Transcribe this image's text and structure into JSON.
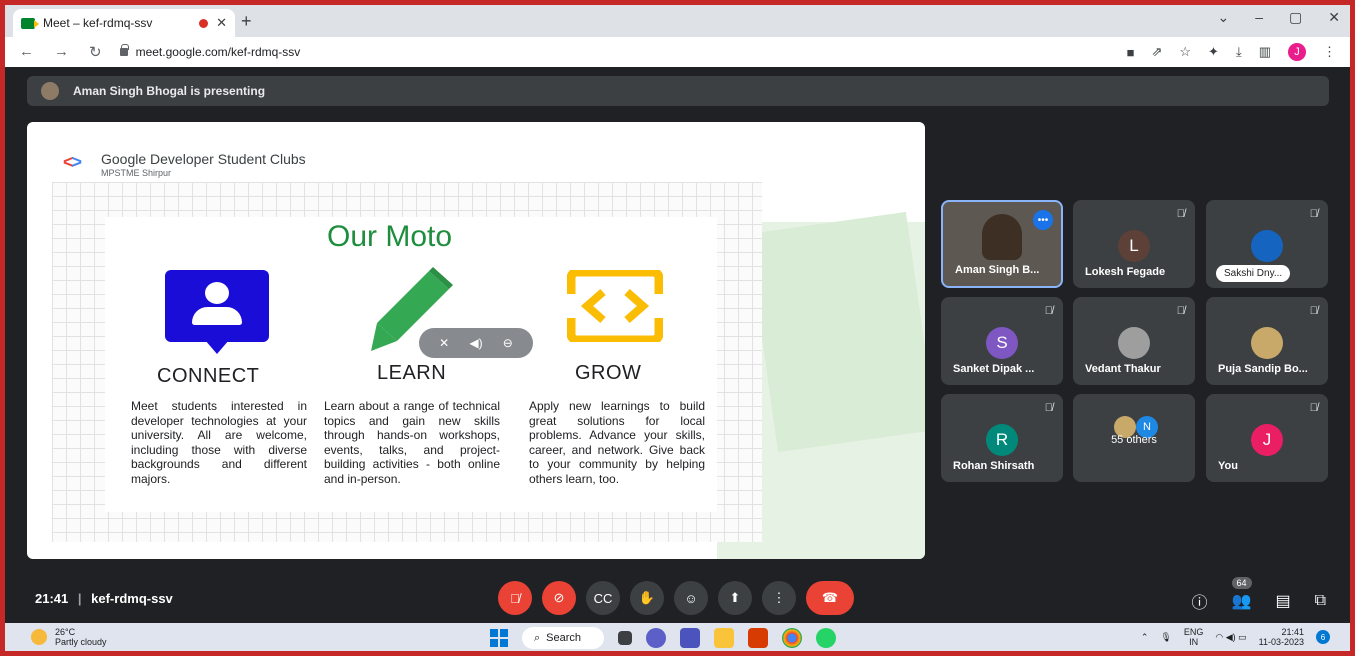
{
  "browser": {
    "tab_title": "Meet – kef-rdmq-ssv",
    "url": "meet.google.com/kef-rdmq-ssv",
    "profile_initial": "J"
  },
  "banner": {
    "text": "Aman Singh Bhogal is presenting"
  },
  "slide": {
    "org": "Google Developer Student Clubs",
    "chapter": "MPSTME Shirpur",
    "heading": "Our Moto",
    "columns": [
      {
        "title": "CONNECT",
        "text": "Meet students interested in developer technologies at your university. All are welcome, including those with diverse backgrounds and different majors."
      },
      {
        "title": "LEARN",
        "text": "Learn about a range of technical topics and gain new skills through hands-on workshops, events, talks, and project-building activities - both online and in-person."
      },
      {
        "title": "GROW",
        "text": "Apply new learnings to build great solutions for local problems. Advance your skills, career, and network. Give back to your community by helping others learn, too."
      }
    ]
  },
  "participants": [
    {
      "name": "Aman Singh B...",
      "initial": "",
      "color": "#6b5a45",
      "muted": false,
      "active": true
    },
    {
      "name": "Lokesh Fegade",
      "initial": "L",
      "color": "#5d4037",
      "muted": true
    },
    {
      "name": "Sakshi Dny...",
      "initial": "",
      "color": "#1565c0",
      "muted": true,
      "pill": true
    },
    {
      "name": "Sanket Dipak ...",
      "initial": "S",
      "color": "#7e57c2",
      "muted": true
    },
    {
      "name": "Vedant Thakur",
      "initial": "",
      "color": "#9e9e9e",
      "muted": true
    },
    {
      "name": "Puja Sandip Bo...",
      "initial": "",
      "color": "#c8a96a",
      "muted": true
    },
    {
      "name": "Rohan Shirsath",
      "initial": "R",
      "color": "#00897b",
      "muted": true
    },
    {
      "name": "55 others",
      "initial": "N",
      "color": "#1e88e5",
      "muted": false,
      "others": true
    },
    {
      "name": "You",
      "initial": "J",
      "color": "#e91e63",
      "muted": true
    }
  ],
  "meeting": {
    "time": "21:41",
    "code": "kef-rdmq-ssv",
    "people_count": "64"
  },
  "taskbar": {
    "temperature": "26°C",
    "weather": "Partly cloudy",
    "search": "Search",
    "lang": "ENG",
    "region": "IN",
    "clock_time": "21:41",
    "clock_date": "11-03-2023",
    "notifications": "6"
  }
}
